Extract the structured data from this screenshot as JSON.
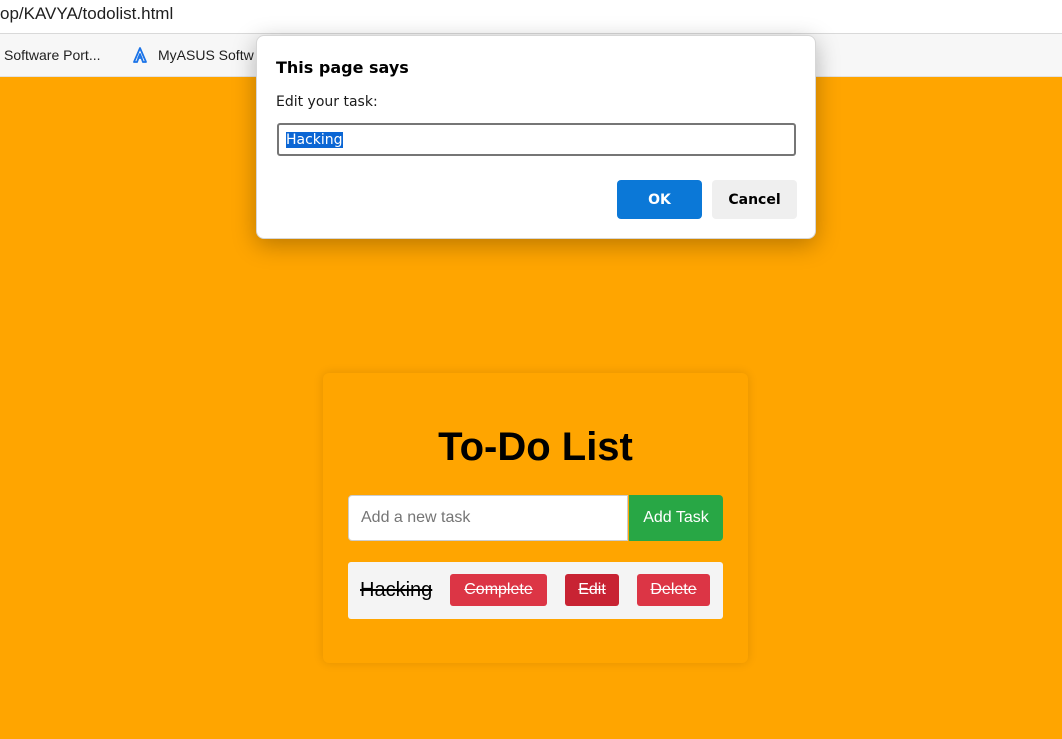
{
  "browser": {
    "address_text": "op/KAVYA/todolist.html",
    "bookmarks": [
      {
        "label": "Software Port...",
        "icon": "none"
      },
      {
        "label": "MyASUS Softw",
        "icon": "asus-logo-icon"
      }
    ]
  },
  "todo": {
    "title": "To-Do List",
    "input_placeholder": "Add a new task",
    "input_value": "",
    "add_button_label": "Add Task",
    "tasks": [
      {
        "text": "Hacking",
        "completed": true,
        "complete_label": "Complete",
        "edit_label": "Edit",
        "delete_label": "Delete"
      }
    ]
  },
  "dialog": {
    "title": "This page says",
    "message": "Edit your task:",
    "input_value": "Hacking",
    "ok_label": "OK",
    "cancel_label": "Cancel"
  },
  "colors": {
    "page_background": "#ffa500",
    "add_button": "#28a745",
    "danger_button": "#dc3545",
    "danger_button_hover": "#c82333",
    "dialog_ok": "#0b78d7"
  }
}
